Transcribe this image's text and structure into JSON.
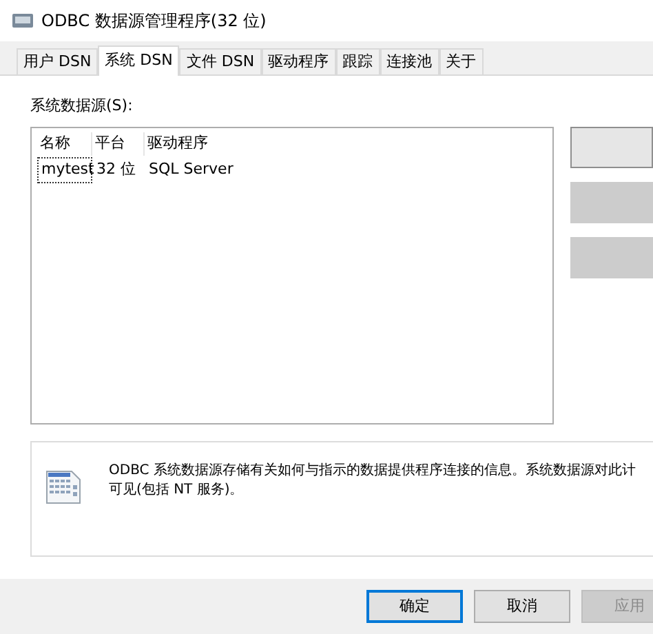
{
  "window": {
    "title": "ODBC 数据源管理程序(32 位)"
  },
  "tabs": [
    {
      "label": "用户 DSN",
      "selected": false
    },
    {
      "label": "系统 DSN",
      "selected": true
    },
    {
      "label": "文件 DSN",
      "selected": false
    },
    {
      "label": "驱动程序",
      "selected": false
    },
    {
      "label": "跟踪",
      "selected": false
    },
    {
      "label": "连接池",
      "selected": false
    },
    {
      "label": "关于",
      "selected": false
    }
  ],
  "list": {
    "label": "系统数据源(S):",
    "columns": [
      "名称",
      "平台",
      "驱动程序"
    ],
    "rows": [
      {
        "cells": [
          "mytest",
          "32 位",
          "SQL Server"
        ],
        "focused": true
      }
    ]
  },
  "side_buttons": [
    {
      "disabled": false
    },
    {
      "disabled": true
    },
    {
      "disabled": true
    }
  ],
  "info": {
    "lines": [
      "ODBC 系统数据源存储有关如何与指示的数据提供程序连接的信息。系统数据源对此计",
      "可见(包括 NT 服务)。"
    ]
  },
  "buttons": [
    {
      "label": "确定",
      "default": true,
      "disabled": false
    },
    {
      "label": "取消",
      "default": false,
      "disabled": false
    },
    {
      "label": "应用",
      "default": false,
      "disabled": true
    }
  ]
}
